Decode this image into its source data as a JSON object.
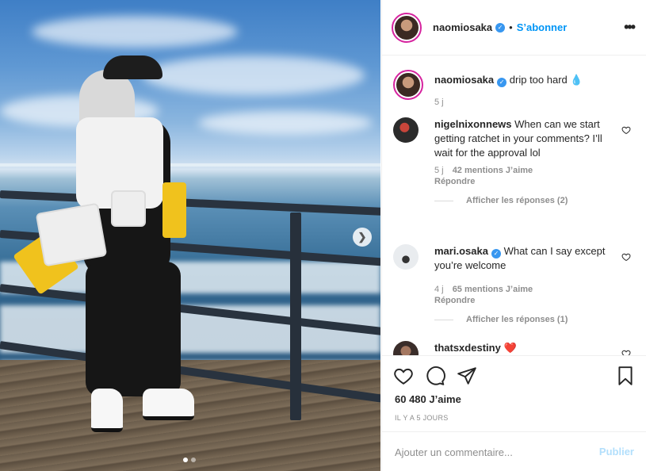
{
  "post": {
    "slide_count": 2,
    "active_slide": 1
  },
  "header": {
    "username": "naomiosaka",
    "separator": "•",
    "follow_label": "S’abonner"
  },
  "caption": {
    "username": "naomiosaka",
    "text": "drip too hard",
    "emoji": "💧",
    "time": "5 j"
  },
  "comments": [
    {
      "username": "nigelnixonnews",
      "text": "When can we start getting ratchet in your comments? I’ll wait for the approval lol",
      "time": "5 j",
      "likes": "42 mentions J’aime",
      "reply": "Répondre",
      "view_replies": "Afficher les réponses (2)"
    },
    {
      "username": "mari.osaka",
      "text": "What can I say except you’re welcome",
      "time": "4 j",
      "likes": "65 mentions J’aime",
      "reply": "Répondre",
      "view_replies": "Afficher les réponses (1)"
    },
    {
      "username": "thatsxdestiny",
      "text": "❤️"
    }
  ],
  "actions": {
    "likes": "60 480 J’aime",
    "posted_ago": "IL Y A 5 JOURS"
  },
  "add_comment": {
    "placeholder": "Ajouter un commentaire...",
    "publish_label": "Publier"
  },
  "colors": {
    "link_blue": "#0095f6",
    "publish_disabled": "#b2dffc",
    "verified": "#3897f0"
  }
}
